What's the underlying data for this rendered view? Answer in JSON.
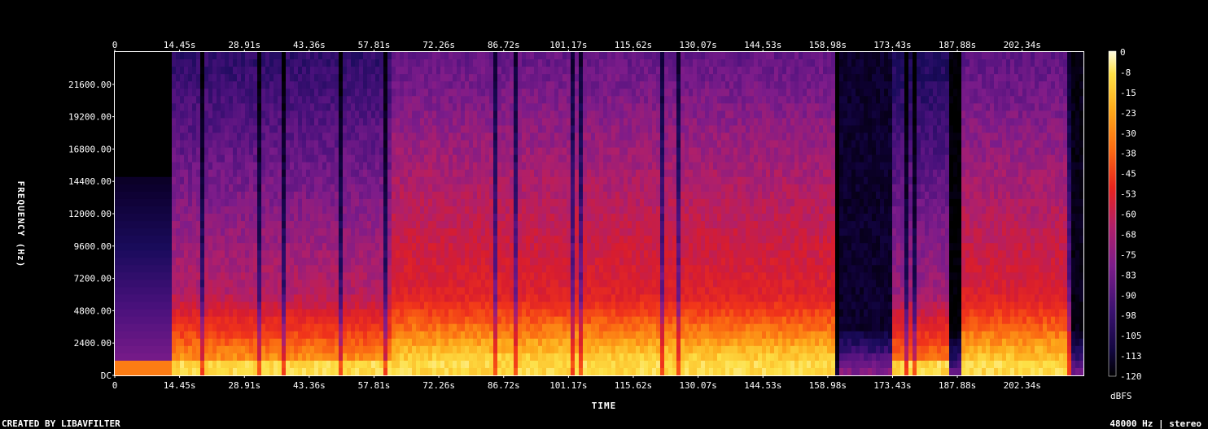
{
  "footer": {
    "created_by": "CREATED BY LIBAVFILTER",
    "format": "48000 Hz | stereo"
  },
  "chart_data": {
    "type": "heatmap",
    "xlabel": "TIME",
    "ylabel": "FREQUENCY (Hz)",
    "colorbar_label": "dBFS",
    "x_ticks": [
      "0",
      "14.45s",
      "28.91s",
      "43.36s",
      "57.81s",
      "72.26s",
      "86.72s",
      "101.17s",
      "115.62s",
      "130.07s",
      "144.53s",
      "158.98s",
      "173.43s",
      "187.88s",
      "202.34s"
    ],
    "y_ticks": [
      "DC",
      "2400.00",
      "4800.00",
      "7200.00",
      "9600.00",
      "12000.00",
      "14400.00",
      "16800.00",
      "19200.00",
      "21600.00"
    ],
    "colorbar_ticks": [
      "0",
      "-8",
      "-15",
      "-23",
      "-30",
      "-38",
      "-45",
      "-53",
      "-60",
      "-68",
      "-75",
      "-83",
      "-90",
      "-98",
      "-105",
      "-113",
      "-120"
    ],
    "xlim_s": [
      0,
      216
    ],
    "ylim_hz": [
      0,
      24000
    ],
    "zlim_dbfs": [
      -120,
      0
    ],
    "colormap": [
      "#000000",
      "#0d0030",
      "#1a0b5c",
      "#4a117c",
      "#7d1c8a",
      "#b01f6a",
      "#d81d2e",
      "#f0331a",
      "#fb6d12",
      "#fdaa1a",
      "#fde046",
      "#fffce0"
    ],
    "segments": [
      {
        "t_start": 0,
        "t_end": 12.5,
        "description_level": "silence with low-frequency onset"
      },
      {
        "t_start": 12.5,
        "t_end": 61.5,
        "level_db_mid": -70
      },
      {
        "t_start": 61.5,
        "t_end": 161,
        "level_db_mid": -58
      },
      {
        "t_start": 161,
        "t_end": 173,
        "level_db_mid": -110
      },
      {
        "t_start": 173,
        "t_end": 186.5,
        "level_db_mid": -75
      },
      {
        "t_start": 186.5,
        "t_end": 188.5,
        "level_db_mid": -120
      },
      {
        "t_start": 188.5,
        "t_end": 213.5,
        "level_db_mid": -60
      },
      {
        "t_start": 213.5,
        "t_end": 216,
        "level_db_mid": -115
      }
    ]
  }
}
